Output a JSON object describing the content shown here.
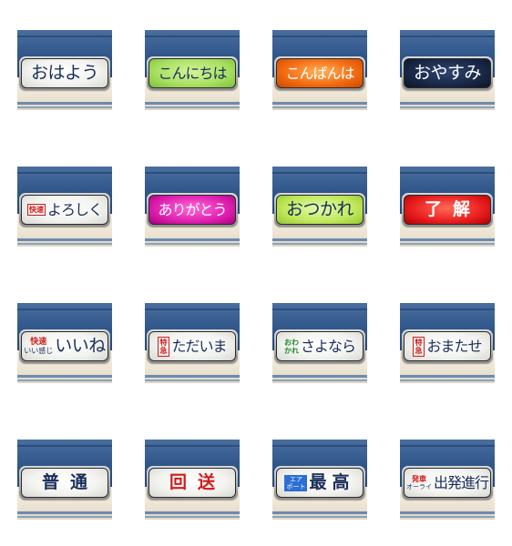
{
  "colors": {
    "text_navy": "#1a2e5a",
    "panel_green": "#a8e060",
    "panel_orange": "#f26a10",
    "panel_dark": "#16233f",
    "panel_magenta": "#e020b0",
    "panel_lime": "#bfe85a",
    "panel_red": "#e81e1e",
    "accent_red": "#d21b1b"
  },
  "stickers": [
    {
      "text": "おはよう"
    },
    {
      "text": "こんにちは"
    },
    {
      "text": "こんばんは"
    },
    {
      "text": "おやすみ"
    },
    {
      "tag": "快速",
      "text": "よろしく"
    },
    {
      "text": "ありがとう"
    },
    {
      "text": "おつかれ"
    },
    {
      "text": "了解"
    },
    {
      "tag_top": "快速",
      "tag_bottom": "いい感じ",
      "text": "いいね"
    },
    {
      "tag": "特急",
      "text": "ただいま"
    },
    {
      "tag_top": "おわ",
      "tag_bottom": "かれ",
      "text": "さよなら"
    },
    {
      "tag": "特急",
      "text": "おまたせ"
    },
    {
      "text": "普通"
    },
    {
      "text": "回送"
    },
    {
      "tag_top": "エア",
      "tag_bottom": "ポート",
      "text": "最高"
    },
    {
      "tag_top": "発車",
      "tag_bottom": "オーライ",
      "text": "出発進行"
    }
  ]
}
